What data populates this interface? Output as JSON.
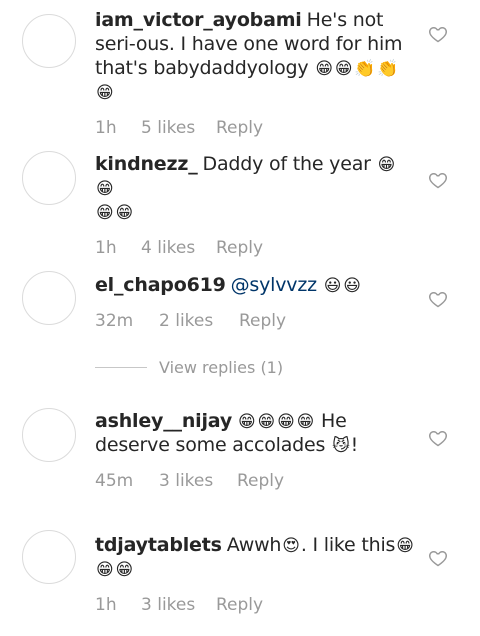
{
  "comments": [
    {
      "username": "iam_victor_ayobami",
      "text": "He's not seri-ous. I have one word for him that's babydaddyology",
      "emojis": [
        "😁",
        "😁",
        "👏",
        "👏",
        "😁"
      ],
      "time": "1h",
      "likes": "5 likes",
      "reply": "Reply"
    },
    {
      "username": "kindnezz_",
      "text": "Daddy of the year",
      "emojis": [
        "😁",
        "😁",
        "😁",
        "😁"
      ],
      "time": "1h",
      "likes": "4 likes",
      "reply": "Reply"
    },
    {
      "username": "el_chapo619",
      "mention": "@sylvvzz",
      "emojis": [
        "😃",
        "😃"
      ],
      "time": "32m",
      "likes": "2 likes",
      "reply": "Reply"
    },
    {
      "username": "ashley__nijay",
      "emojis": [
        "😁",
        "😁",
        "😁",
        "😁"
      ],
      "text": "He deserve some accolades",
      "trailing_emoji": "😼",
      "trailing_text": "!",
      "time": "45m",
      "likes": "3 likes",
      "reply": "Reply"
    },
    {
      "username": "tdjaytablets",
      "text": "Awwh",
      "mid_emoji": "😍",
      "text2": ". I like this",
      "emojis": [
        "😁",
        "😁",
        "😁"
      ],
      "time": "1h",
      "likes": "3 likes",
      "reply": "Reply"
    }
  ],
  "view_replies": "View replies (1)",
  "icons": {
    "like": "heart-outline-icon"
  },
  "colors": {
    "meta": "#999999",
    "text": "#262626",
    "divider": "#c7c7c7"
  }
}
